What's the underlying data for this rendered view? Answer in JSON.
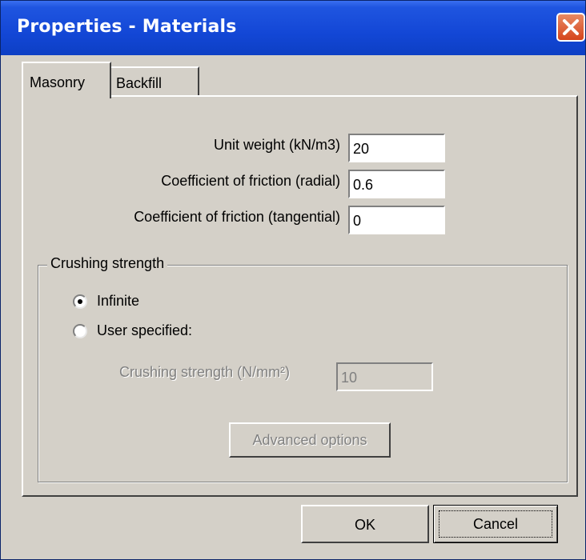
{
  "window": {
    "title": "Properties - Materials",
    "close_icon": "close-x-icon"
  },
  "tabs": [
    {
      "label": "Masonry",
      "active": true
    },
    {
      "label": "Backfill",
      "active": false
    }
  ],
  "fields": {
    "unit_weight": {
      "label": "Unit weight (kN/m3)",
      "value": "20"
    },
    "friction_radial": {
      "label": "Coefficient of friction (radial)",
      "value": "0.6"
    },
    "friction_tangential": {
      "label": "Coefficient of friction (tangential)",
      "value": "0"
    }
  },
  "crushing": {
    "group_label": "Crushing strength",
    "options": [
      {
        "label": "Infinite",
        "selected": true
      },
      {
        "label": "User specified:",
        "selected": false
      }
    ],
    "strength_label": "Crushing strength (N/mm²)",
    "strength_value": "10",
    "advanced_label": "Advanced options"
  },
  "buttons": {
    "ok": "OK",
    "cancel": "Cancel"
  }
}
